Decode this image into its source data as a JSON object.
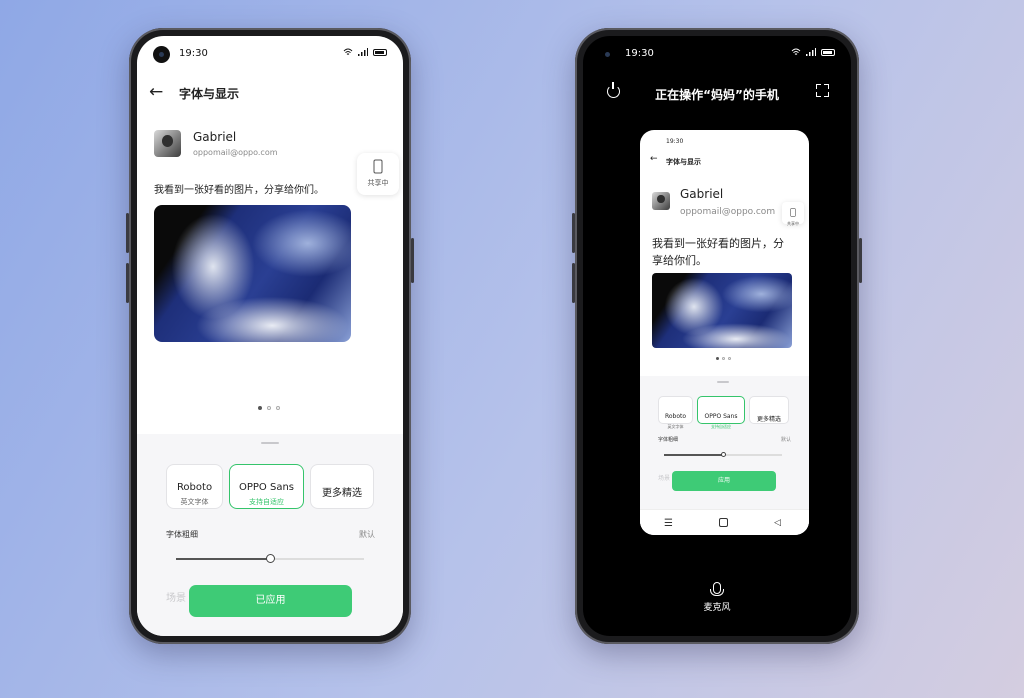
{
  "status": {
    "time": "19:30"
  },
  "left": {
    "title": "字体与显示",
    "user": {
      "name": "Gabriel",
      "email": "oppomail@oppo.com"
    },
    "message": "我看到一张好看的图片，分享给你们。",
    "share_label": "共享中",
    "fonts": [
      {
        "name": "Roboto",
        "sub": "英文字体"
      },
      {
        "name": "OPPO Sans",
        "sub": "支持自适应"
      },
      {
        "name": "更多精选",
        "sub": ""
      }
    ],
    "weight_label": "字体粗细",
    "weight_default": "默认",
    "weight_level": 0.5,
    "scene_label": "场景",
    "apply_label": "已应用",
    "page_index": 1,
    "page_count": 3
  },
  "right": {
    "title": "正在操作“妈妈”的手机",
    "mini": {
      "time": "19:30",
      "title": "字体与显示",
      "user": {
        "name": "Gabriel",
        "email": "oppomail@oppo.com"
      },
      "share_label": "共享中",
      "message_line1": "我看到一张好看的图片，分",
      "message_line2": "享给你们。",
      "fonts": [
        {
          "name": "Roboto",
          "sub": "英文字体"
        },
        {
          "name": "OPPO Sans",
          "sub": "支持自适应"
        },
        {
          "name": "更多精选",
          "sub": ""
        }
      ],
      "weight_label": "字体粗细",
      "weight_default": "默认",
      "scene_label": "场景",
      "apply_label": "应用"
    },
    "mic_label": "麦克风"
  },
  "colors": {
    "accent": "#3ecb76",
    "background_start": "#8fa8e6",
    "background_end": "#d4cde0"
  },
  "icons": [
    "back-arrow-icon",
    "share-phone-icon",
    "wifi-icon",
    "signal-icon",
    "battery-icon",
    "power-icon",
    "expand-icon",
    "microphone-icon",
    "menu-icon",
    "home-icon",
    "back-triangle-icon"
  ]
}
